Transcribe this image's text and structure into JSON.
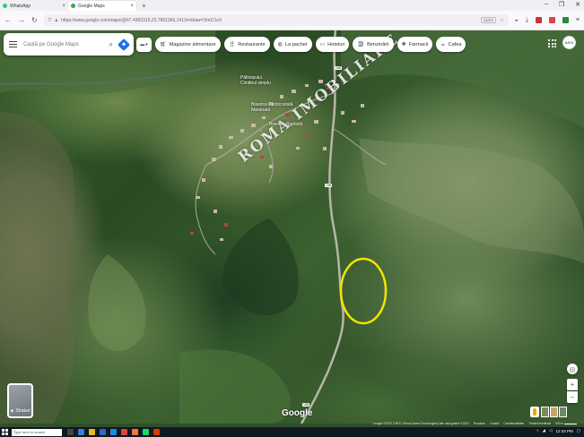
{
  "browser": {
    "tabs": [
      {
        "label": "WhatsApp",
        "favicon_color": "#25d366",
        "active": false
      },
      {
        "label": "Google Maps",
        "favicon_color": "#34a853",
        "active": true
      }
    ],
    "new_tab_label": "+",
    "url": "https://www.google.com/maps/@47.4360315,23.7861366,1412m/data=!3m1!1e3",
    "zoom": "110%"
  },
  "maps": {
    "search_placeholder": "Caută pe Google Maps",
    "chips": [
      {
        "label": "Magazine alimentare",
        "icon": "cart-icon"
      },
      {
        "label": "Restaurante",
        "icon": "fork-knife-icon"
      },
      {
        "label": "La pachet",
        "icon": "takeout-icon"
      },
      {
        "label": "Hoteluri",
        "icon": "bed-icon"
      },
      {
        "label": "Benzinării",
        "icon": "fuel-icon"
      },
      {
        "label": "Farmacii",
        "icon": "pharmacy-icon"
      },
      {
        "label": "Cafea",
        "icon": "coffee-icon"
      }
    ],
    "account_label": "KATO",
    "layers_label": "Straturi",
    "watermark": "ROMA IMOBILIARE",
    "labels": {
      "place1": "Păltinișului",
      "place1_sub": "Cimitirul simplu",
      "place2": "Biserica Penticostală",
      "place2_sub": "Maranata",
      "place3": "Biserica Baptistă"
    },
    "road_shields": [
      "18B",
      "18B",
      "18B"
    ],
    "google_logo": "Google",
    "attribution": [
      "Imagini ©2022 CNES / Airbus,Maxar Technologies,Date cartografice ©2022",
      "România",
      "Condiții",
      "Confidențialitate",
      "Trimiteți feedback",
      "500 m"
    ]
  },
  "taskbar": {
    "search_placeholder": "Type here to search",
    "time": "12:34 PM"
  },
  "colors": {
    "highlight_circle": "#f5e400",
    "accent": "#1a73e8"
  }
}
